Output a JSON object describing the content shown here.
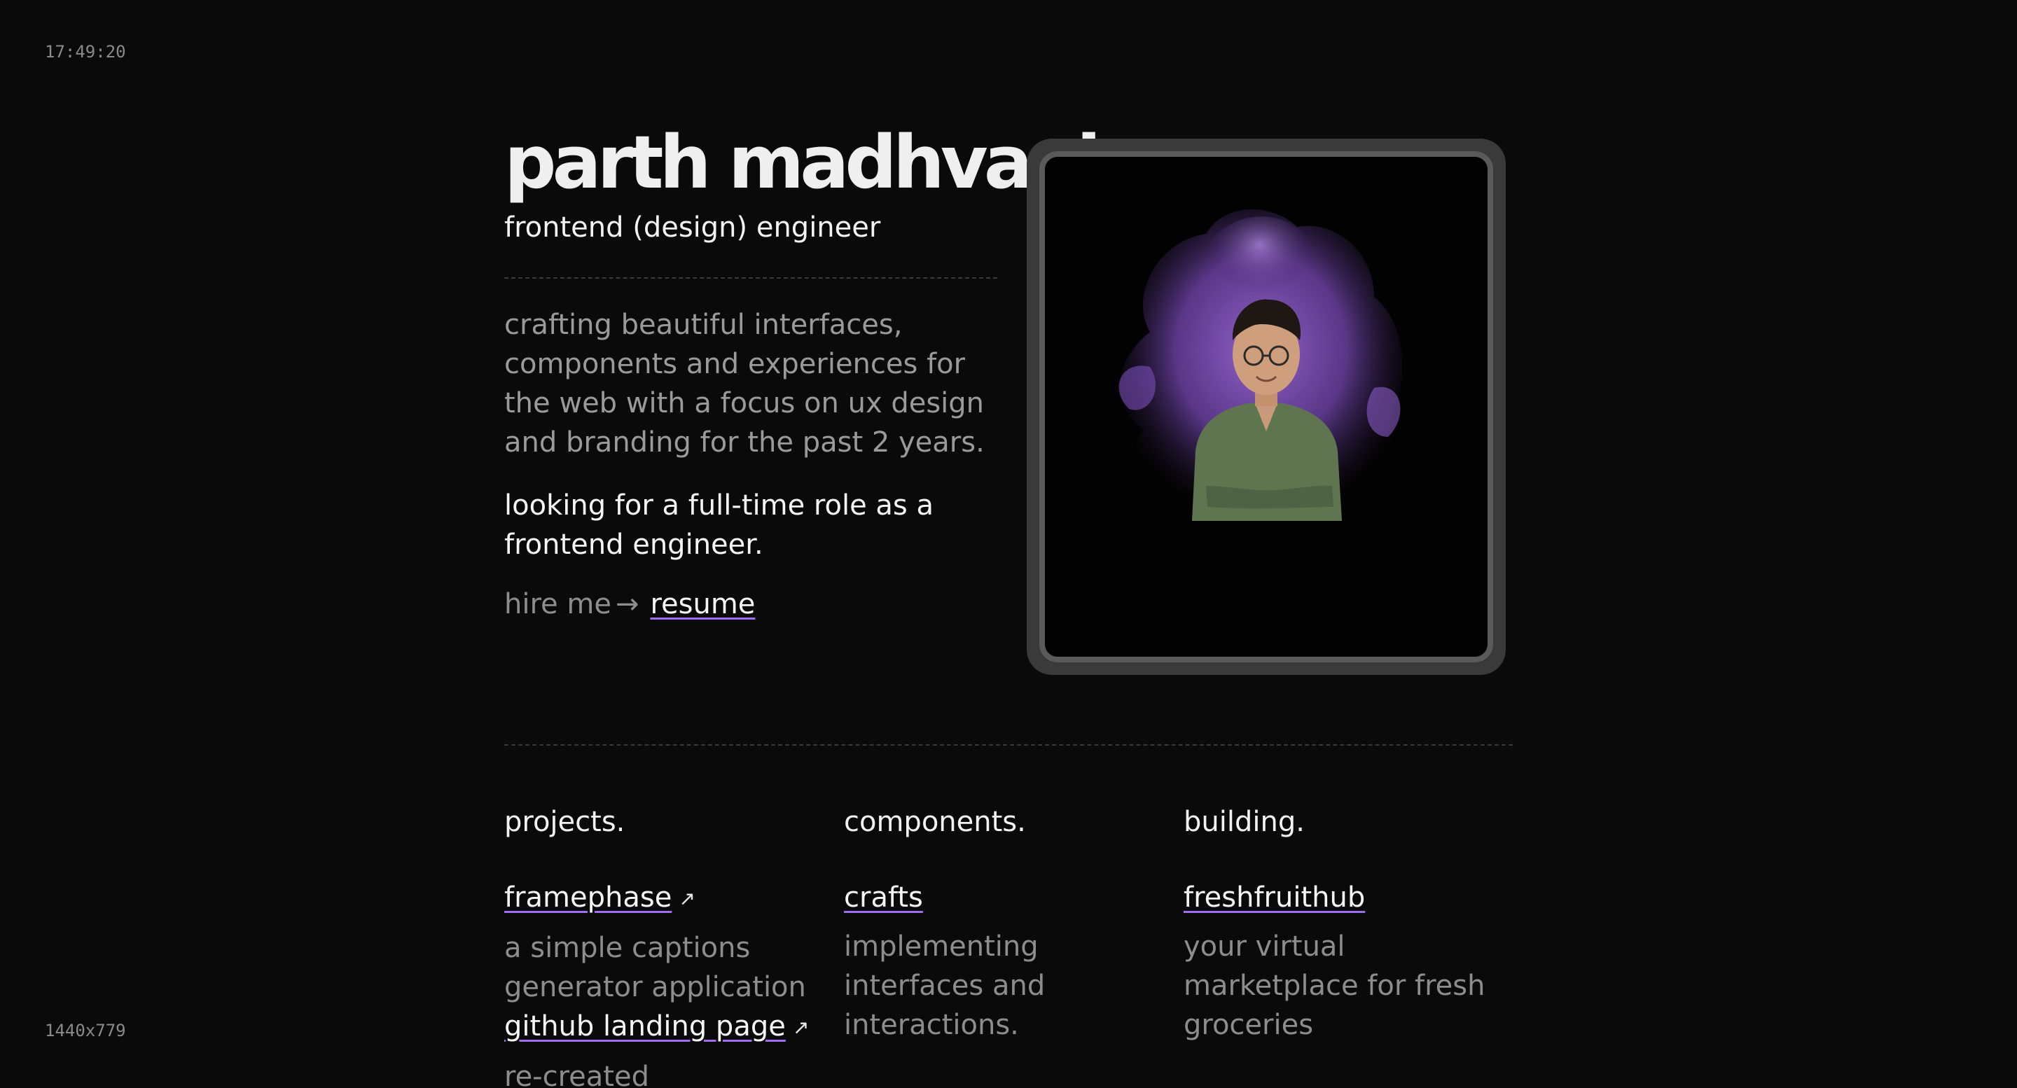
{
  "overlay": {
    "clock": "17:49:20",
    "viewport": "1440x779"
  },
  "hero": {
    "name": "parth madhvani",
    "role": "frontend (design) engineer",
    "bio": "crafting beautiful interfaces, components and experiences for the web with a focus on ux design and branding for the past 2 years.",
    "looking": "looking for a full-time role as a frontend engineer.",
    "hire_label": "hire me",
    "hire_arrow": "→",
    "resume_link": "resume"
  },
  "photo": {
    "icon": "portrait-photo",
    "accent_color": "#8e5fd0"
  },
  "sections": {
    "projects": {
      "heading": "projects.",
      "items": [
        {
          "title": "framephase",
          "external_icon": "↗",
          "description": "a simple captions generator application"
        },
        {
          "title": "github landing page",
          "external_icon": "↗",
          "description": "re-created"
        }
      ]
    },
    "components": {
      "heading": "components.",
      "items": [
        {
          "title": "crafts",
          "description": "implementing interfaces and interactions."
        }
      ]
    },
    "building": {
      "heading": "building.",
      "items": [
        {
          "title": "freshfruithub",
          "description": "your virtual marketplace for fresh groceries"
        }
      ]
    }
  },
  "colors": {
    "background": "#0a0a0a",
    "link_underline": "#a06cf0",
    "muted_text": "#8d8d8d",
    "primary_text": "#f2f2f2"
  }
}
